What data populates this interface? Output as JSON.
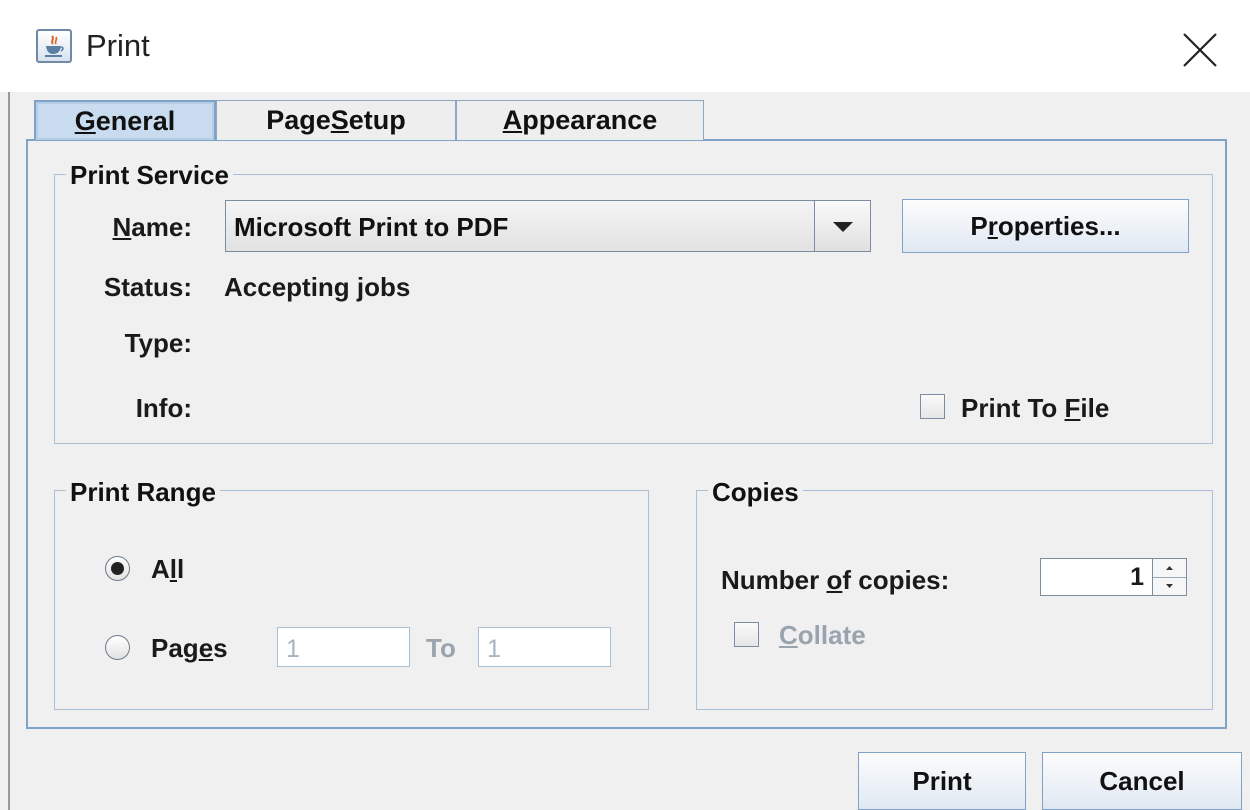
{
  "window": {
    "title": "Print"
  },
  "tabs": [
    {
      "label_pre": "",
      "label_u": "G",
      "label_post": "eneral",
      "selected": true
    },
    {
      "label_pre": "Page ",
      "label_u": "S",
      "label_post": "etup",
      "selected": false
    },
    {
      "label_pre": "",
      "label_u": "A",
      "label_post": "ppearance",
      "selected": false
    }
  ],
  "print_service": {
    "group_title": "Print Service",
    "name_label_u": "N",
    "name_label_rest": "ame:",
    "name_value": "Microsoft Print to PDF",
    "properties_pre": "P",
    "properties_u": "r",
    "properties_post": "operties...",
    "status_label": "Status:",
    "status_value": "Accepting jobs",
    "type_label": "Type:",
    "info_label": "Info:",
    "print_to_file_pre": "Print To ",
    "print_to_file_u": "F",
    "print_to_file_post": "ile",
    "print_to_file_checked": false
  },
  "print_range": {
    "group_title": "Print Range",
    "all_pre": "A",
    "all_u": "l",
    "all_post": "l",
    "all_selected": true,
    "pages_pre": "Pag",
    "pages_u": "e",
    "pages_post": "s",
    "pages_from": "1",
    "to_label": "To",
    "pages_to": "1"
  },
  "copies": {
    "group_title": "Copies",
    "number_pre": "Number ",
    "number_u": "o",
    "number_post": "f copies:",
    "count": "1",
    "collate_u": "C",
    "collate_post": "ollate",
    "collate_checked": false
  },
  "footer": {
    "print_label": "Print",
    "cancel_label": "Cancel"
  },
  "colors": {
    "accent_border": "#7fa2c6",
    "active_tab": "#c9dbee",
    "panel_bg": "#f0f0f0"
  },
  "icons": {
    "app": "java-cup-icon",
    "close": "close-icon",
    "dropdown": "chevron-down-icon"
  }
}
